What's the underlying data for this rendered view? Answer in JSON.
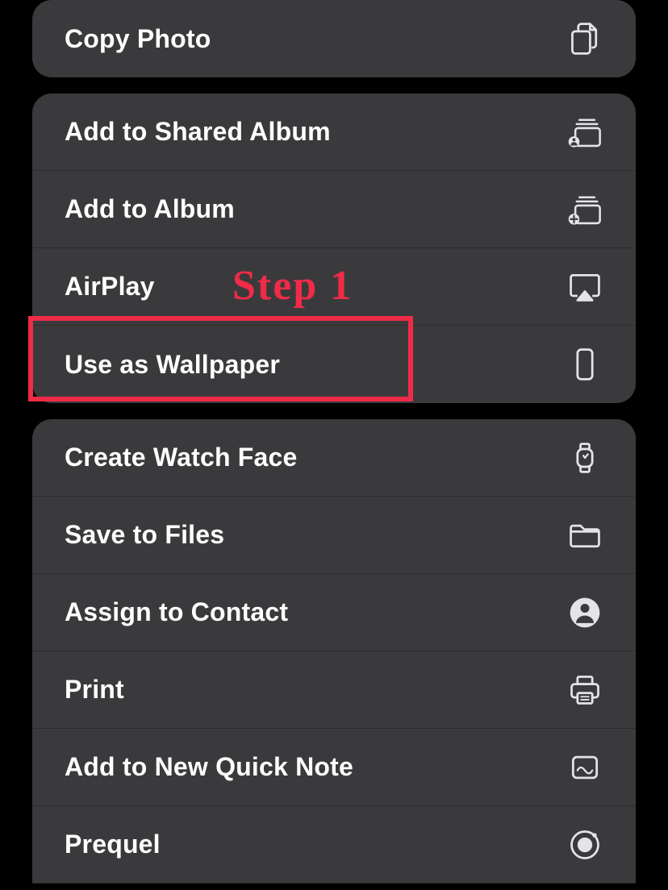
{
  "annotation": {
    "step_label": "Step 1"
  },
  "menu": {
    "group1": [
      {
        "label": "Copy Photo",
        "icon": "copy-docs-icon"
      }
    ],
    "group2": [
      {
        "label": "Add to Shared Album",
        "icon": "shared-album-icon"
      },
      {
        "label": "Add to Album",
        "icon": "add-album-icon"
      },
      {
        "label": "AirPlay",
        "icon": "airplay-icon"
      },
      {
        "label": "Use as Wallpaper",
        "icon": "phone-rect-icon"
      }
    ],
    "group3": [
      {
        "label": "Create Watch Face",
        "icon": "watch-icon"
      },
      {
        "label": "Save to Files",
        "icon": "folder-icon"
      },
      {
        "label": "Assign to Contact",
        "icon": "contact-circle-icon"
      },
      {
        "label": "Print",
        "icon": "printer-icon"
      },
      {
        "label": "Add to New Quick Note",
        "icon": "quicknote-icon"
      },
      {
        "label": "Prequel",
        "icon": "prequel-icon"
      }
    ]
  }
}
